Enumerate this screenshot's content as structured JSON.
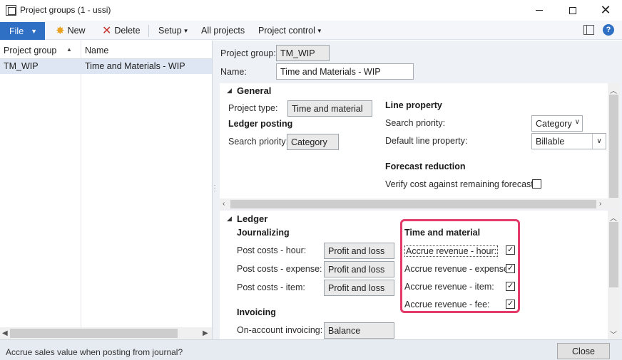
{
  "window": {
    "title": "Project groups (1 - ussi)",
    "minimize": "—",
    "maximize": "☐",
    "close": "✕"
  },
  "toolbar": {
    "file_label": "File",
    "new_label": "New",
    "delete_label": "Delete",
    "setup_label": "Setup",
    "all_projects_label": "All projects",
    "project_control_label": "Project control",
    "help_label": "?"
  },
  "grid": {
    "columns": [
      "Project group",
      "Name"
    ],
    "rows": [
      {
        "project_group": "TM_WIP",
        "name": "Time and Materials - WIP"
      }
    ]
  },
  "header_fields": {
    "project_group_label": "Project group:",
    "project_group_value": "TM_WIP",
    "name_label": "Name:",
    "name_value": "Time and Materials - WIP"
  },
  "general": {
    "title": "General",
    "project_type_label": "Project type:",
    "project_type_value": "Time and material",
    "ledger_posting_title": "Ledger posting",
    "ledger_search_priority_label": "Search priority:",
    "ledger_search_priority_value": "Category",
    "line_property_title": "Line property",
    "line_search_priority_label": "Search priority:",
    "line_search_priority_value": "Category",
    "default_line_property_label": "Default line property:",
    "default_line_property_value": "Billable",
    "forecast_reduction_title": "Forecast reduction",
    "verify_cost_label": "Verify cost against remaining forecast:",
    "verify_cost_checked": false
  },
  "ledger": {
    "title": "Ledger",
    "journalizing_title": "Journalizing",
    "post_costs_hour_label": "Post costs - hour:",
    "post_costs_hour_value": "Profit and loss",
    "post_costs_expense_label": "Post costs - expense:",
    "post_costs_expense_value": "Profit and loss",
    "post_costs_item_label": "Post costs - item:",
    "post_costs_item_value": "Profit and loss",
    "invoicing_title": "Invoicing",
    "on_account_label": "On-account invoicing:",
    "on_account_value": "Balance",
    "time_material_title": "Time and material",
    "accrue_hour_label": "Accrue revenue - hour:",
    "accrue_hour_checked": true,
    "accrue_expense_label": "Accrue revenue - expense:",
    "accrue_expense_checked": true,
    "accrue_item_label": "Accrue revenue - item:",
    "accrue_item_checked": true,
    "accrue_fee_label": "Accrue revenue - fee:",
    "accrue_fee_checked": true
  },
  "status": {
    "text": "Accrue sales value when posting from journal?",
    "close_label": "Close"
  },
  "colors": {
    "accent": "#2f6fc4",
    "highlight": "#e33c6a",
    "selected_row": "#dde6f2"
  }
}
